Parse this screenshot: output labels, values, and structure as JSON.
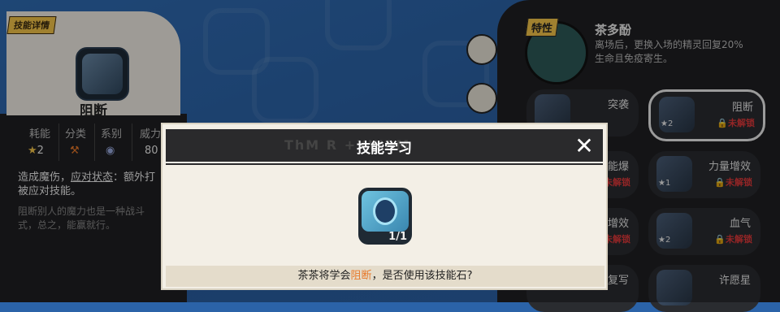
{
  "skill_card": {
    "tag": "技能详情",
    "name": "阻断",
    "stats": {
      "labels": [
        "耗能",
        "分类",
        "系别",
        "威力"
      ],
      "energy": "2",
      "power": "80"
    },
    "desc_prefix": "造成魔伤，",
    "desc_keyword": "应对状态",
    "desc_suffix": "：额外打",
    "desc_line2": "被应对技能。",
    "flavor_line1": "阻断别人的魔力也是一种战斗",
    "flavor_line2": "式，总之，能赢就行。"
  },
  "trait": {
    "tag": "特性",
    "name": "茶多酚",
    "desc_line1": "离场后，更换入场的精灵回复20%",
    "desc_line2": "生命且免疫寄生。"
  },
  "moves": [
    {
      "name": "突袭",
      "status": "",
      "level": ""
    },
    {
      "name": "阻断",
      "status": "未解锁",
      "level": "2"
    },
    {
      "name": "能爆",
      "status": "未解锁",
      "level": ""
    },
    {
      "name": "力量增效",
      "status": "未解锁",
      "level": "1"
    },
    {
      "name": "增效",
      "status": "未解锁",
      "level": ""
    },
    {
      "name": "血气",
      "status": "未解锁",
      "level": "2"
    },
    {
      "name": "复写",
      "status": "",
      "level": ""
    },
    {
      "name": "许愿星",
      "status": "",
      "level": ""
    }
  ],
  "dialog": {
    "title": "技能学习",
    "shadow_text": "ThM R         +XWRM",
    "close": "✕",
    "stone_count": "1/1",
    "msg_prefix": "茶茶将学会",
    "msg_skill": "阻断",
    "msg_suffix": "，是否使用该技能石?"
  },
  "colors": {
    "accent_orange": "#e8792a",
    "lock_red": "#e0393b",
    "tag_yellow": "#f6c64a"
  }
}
